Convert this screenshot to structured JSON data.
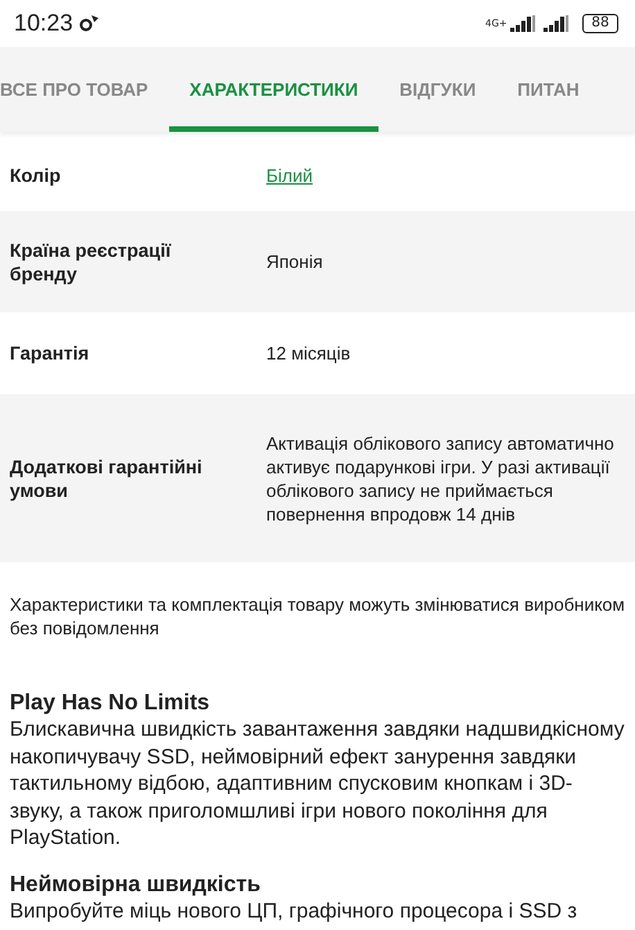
{
  "status_bar": {
    "time": "10:23",
    "network": "4G+",
    "battery": "88"
  },
  "tabs": [
    {
      "label": "ВСЕ ПРО ТОВАР",
      "selected": false
    },
    {
      "label": "ХАРАКТЕРИСТИКИ",
      "selected": true
    },
    {
      "label": "ВІДГУКИ",
      "selected": false
    },
    {
      "label": "ПИТАН",
      "selected": false
    }
  ],
  "specs": [
    {
      "name": "Колір",
      "value": "Білий",
      "kind": "link"
    },
    {
      "name": "Країна реєстрації бренду",
      "value": "Японія",
      "kind": "text"
    },
    {
      "name": "Гарантія",
      "value": "12 місяців",
      "kind": "text"
    },
    {
      "name": "Додаткові гарантійні умови",
      "value": "Активація облікового запису автоматично активує подарункові ігри. У разі активації облікового запису не приймається повернення впродовж 14 днів",
      "kind": "text"
    }
  ],
  "note": "Характеристики та комплектація товару можуть змінюватися виробником без повідомлення",
  "sections": [
    {
      "heading": "Play Has No Limits",
      "text": "Блискавична швидкість завантаження завдяки надшвидкісному накопичувачу SSD, неймовірний ефект занурення завдяки тактильному відбою, адаптивним спусковим кнопкам і 3D-звуку, а також приголомшливі ігри нового покоління для PlayStation."
    },
    {
      "heading": "Неймовірна швидкість",
      "text": "Випробуйте міць нового ЦП, графічного процесора і SSD з"
    }
  ]
}
